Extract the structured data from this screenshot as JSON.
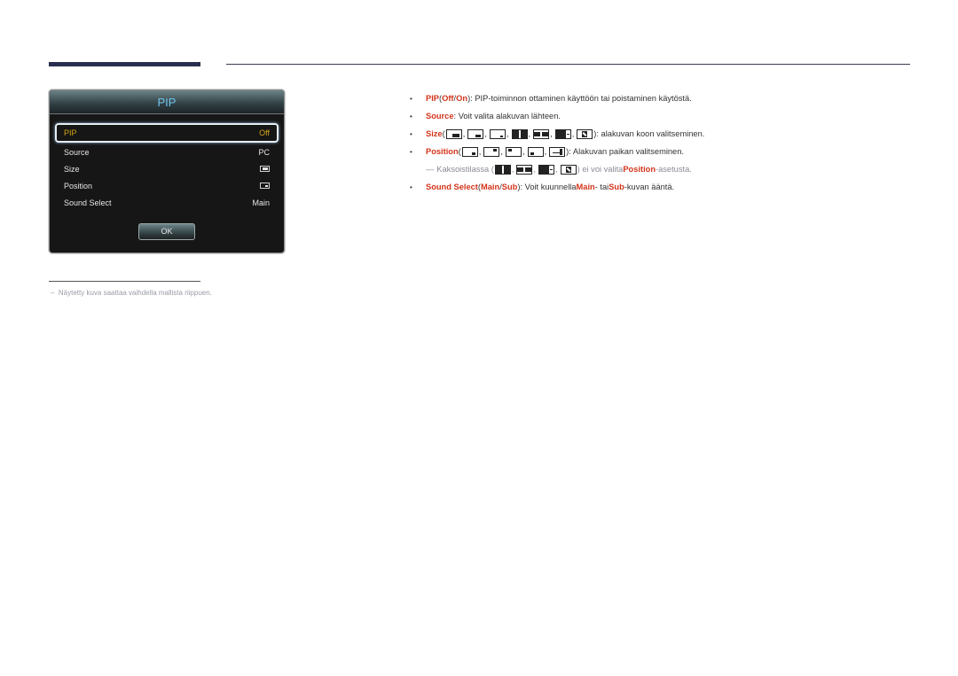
{
  "osd": {
    "title": "PIP",
    "rows": [
      {
        "label": "PIP",
        "value": "Off",
        "selected": true
      },
      {
        "label": "Source",
        "value": "PC"
      },
      {
        "label": "Size",
        "value_icon": "size-icon"
      },
      {
        "label": "Position",
        "value_icon": "position-icon"
      },
      {
        "label": "Sound Select",
        "value": "Main"
      }
    ],
    "ok_label": "OK"
  },
  "footnote": "Näytetty kuva saattaa vaihdella mallista riippuen.",
  "bullets": {
    "pip": {
      "term": "PIP",
      "open": " (",
      "off": "Off",
      "slash": " / ",
      "on": "On",
      "close": ")",
      "text": ": PIP-toiminnon ottaminen käyttöön tai poistaminen käytöstä."
    },
    "source": {
      "term": "Source",
      "text": ": Voit valita alakuvan lähteen."
    },
    "size": {
      "term": "Size",
      "open": " (",
      "close": ")",
      "text": ": alakuvan koon valitseminen."
    },
    "position": {
      "term": "Position",
      "open": " (",
      "close": ")",
      "text": ": Alakuvan paikan valitseminen."
    },
    "note": {
      "dash": "—",
      "prefix": "Kaksoistilassa (",
      "mid": ") ei voi valita ",
      "term": "Position",
      "suffix": "-asetusta."
    },
    "sound": {
      "term": "Sound Select",
      "open": " (",
      "main": "Main",
      "slash": " / ",
      "sub": "Sub",
      "close": ")",
      "text1": ": Voit kuunnella ",
      "main2": "Main",
      "text2": "- tai ",
      "sub2": "Sub",
      "text3": "-kuvan ääntä."
    }
  },
  "bullet_glyph": "•",
  "colors": {
    "accent": "#d4351c",
    "osd_title": "#6fc3ea",
    "osd_selected": "#d6a417"
  }
}
